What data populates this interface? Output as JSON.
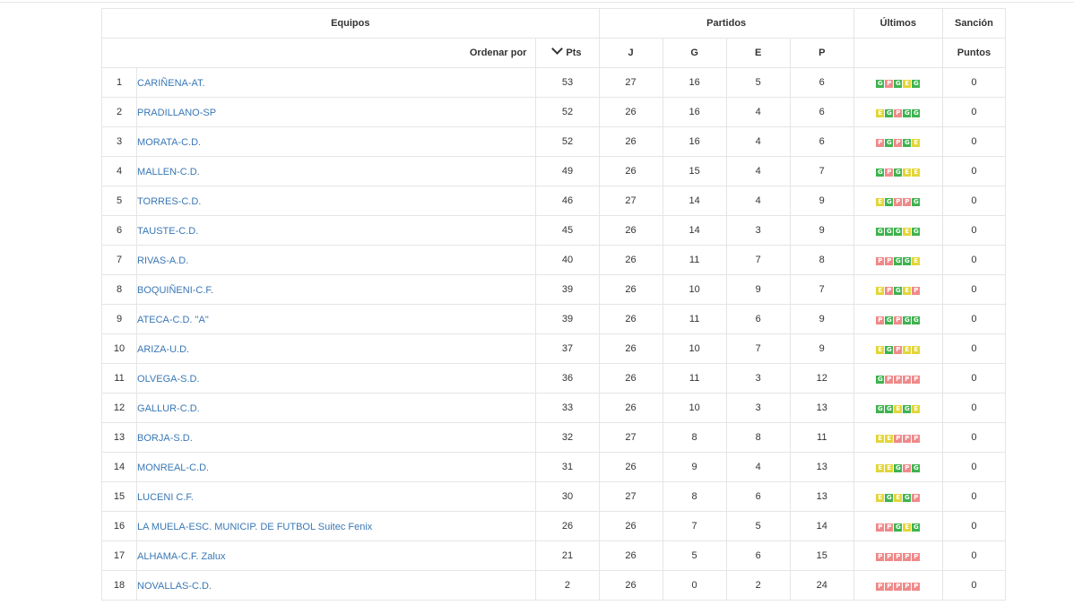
{
  "header": {
    "equipos": "Equipos",
    "partidos": "Partidos",
    "ultimos": "Últimos",
    "sancion": "Sanción",
    "ordenar_por": "Ordenar por",
    "pts": "Pts",
    "j": "J",
    "g": "G",
    "e": "E",
    "p": "P",
    "puntos": "Puntos"
  },
  "colors": {
    "G": "#3fb34f",
    "E": "#e3d63a",
    "P": "#ef8a8a",
    "link": "#3a78b5"
  },
  "rows": [
    {
      "pos": "1",
      "team": "CARIÑENA-AT.",
      "pts": "53",
      "j": "27",
      "g": "16",
      "e": "5",
      "p": "6",
      "last": [
        "G",
        "P",
        "G",
        "E",
        "G"
      ],
      "sancion": "0"
    },
    {
      "pos": "2",
      "team": "PRADILLANO-SP",
      "pts": "52",
      "j": "26",
      "g": "16",
      "e": "4",
      "p": "6",
      "last": [
        "E",
        "G",
        "P",
        "G",
        "G"
      ],
      "sancion": "0"
    },
    {
      "pos": "3",
      "team": "MORATA-C.D.",
      "pts": "52",
      "j": "26",
      "g": "16",
      "e": "4",
      "p": "6",
      "last": [
        "P",
        "G",
        "P",
        "G",
        "E"
      ],
      "sancion": "0"
    },
    {
      "pos": "4",
      "team": "MALLEN-C.D.",
      "pts": "49",
      "j": "26",
      "g": "15",
      "e": "4",
      "p": "7",
      "last": [
        "G",
        "P",
        "G",
        "E",
        "E"
      ],
      "sancion": "0"
    },
    {
      "pos": "5",
      "team": "TORRES-C.D.",
      "pts": "46",
      "j": "27",
      "g": "14",
      "e": "4",
      "p": "9",
      "last": [
        "E",
        "G",
        "P",
        "P",
        "G"
      ],
      "sancion": "0"
    },
    {
      "pos": "6",
      "team": "TAUSTE-C.D.",
      "pts": "45",
      "j": "26",
      "g": "14",
      "e": "3",
      "p": "9",
      "last": [
        "G",
        "G",
        "G",
        "E",
        "G"
      ],
      "sancion": "0"
    },
    {
      "pos": "7",
      "team": "RIVAS-A.D.",
      "pts": "40",
      "j": "26",
      "g": "11",
      "e": "7",
      "p": "8",
      "last": [
        "P",
        "P",
        "G",
        "G",
        "E"
      ],
      "sancion": "0"
    },
    {
      "pos": "8",
      "team": "BOQUIÑENI-C.F.",
      "pts": "39",
      "j": "26",
      "g": "10",
      "e": "9",
      "p": "7",
      "last": [
        "E",
        "P",
        "G",
        "E",
        "P"
      ],
      "sancion": "0"
    },
    {
      "pos": "9",
      "team": "ATECA-C.D. \"A\"",
      "pts": "39",
      "j": "26",
      "g": "11",
      "e": "6",
      "p": "9",
      "last": [
        "P",
        "G",
        "P",
        "G",
        "G"
      ],
      "sancion": "0"
    },
    {
      "pos": "10",
      "team": "ARIZA-U.D.",
      "pts": "37",
      "j": "26",
      "g": "10",
      "e": "7",
      "p": "9",
      "last": [
        "E",
        "G",
        "P",
        "E",
        "E"
      ],
      "sancion": "0"
    },
    {
      "pos": "11",
      "team": "OLVEGA-S.D.",
      "pts": "36",
      "j": "26",
      "g": "11",
      "e": "3",
      "p": "12",
      "last": [
        "G",
        "P",
        "P",
        "P",
        "P"
      ],
      "sancion": "0"
    },
    {
      "pos": "12",
      "team": "GALLUR-C.D.",
      "pts": "33",
      "j": "26",
      "g": "10",
      "e": "3",
      "p": "13",
      "last": [
        "G",
        "G",
        "E",
        "G",
        "E"
      ],
      "sancion": "0"
    },
    {
      "pos": "13",
      "team": "BORJA-S.D.",
      "pts": "32",
      "j": "27",
      "g": "8",
      "e": "8",
      "p": "11",
      "last": [
        "E",
        "E",
        "P",
        "P",
        "P"
      ],
      "sancion": "0"
    },
    {
      "pos": "14",
      "team": "MONREAL-C.D.",
      "pts": "31",
      "j": "26",
      "g": "9",
      "e": "4",
      "p": "13",
      "last": [
        "E",
        "E",
        "G",
        "P",
        "G"
      ],
      "sancion": "0"
    },
    {
      "pos": "15",
      "team": "LUCENI C.F.",
      "pts": "30",
      "j": "27",
      "g": "8",
      "e": "6",
      "p": "13",
      "last": [
        "E",
        "G",
        "E",
        "G",
        "P"
      ],
      "sancion": "0"
    },
    {
      "pos": "16",
      "team": "LA MUELA-ESC. MUNICIP. DE FUTBOL Suitec Fenix",
      "pts": "26",
      "j": "26",
      "g": "7",
      "e": "5",
      "p": "14",
      "last": [
        "P",
        "P",
        "G",
        "E",
        "G"
      ],
      "sancion": "0"
    },
    {
      "pos": "17",
      "team": "ALHAMA-C.F. Zalux",
      "pts": "21",
      "j": "26",
      "g": "5",
      "e": "6",
      "p": "15",
      "last": [
        "P",
        "P",
        "P",
        "P",
        "P"
      ],
      "sancion": "0"
    },
    {
      "pos": "18",
      "team": "NOVALLAS-C.D.",
      "pts": "2",
      "j": "26",
      "g": "0",
      "e": "2",
      "p": "24",
      "last": [
        "P",
        "P",
        "P",
        "P",
        "P"
      ],
      "sancion": "0"
    }
  ]
}
